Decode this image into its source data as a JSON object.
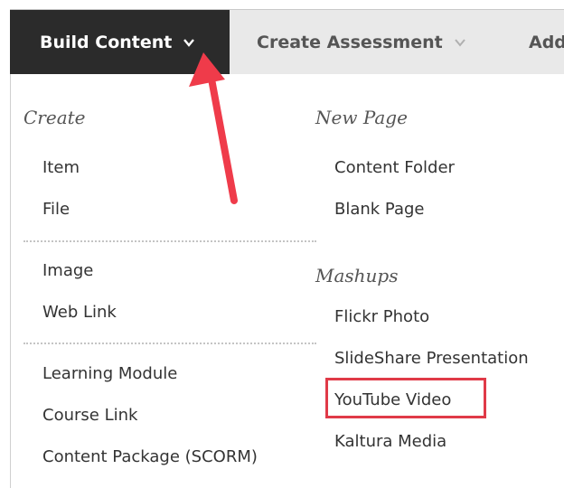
{
  "toolbar": {
    "build_content": "Build Content",
    "create_assessment": "Create Assessment",
    "add_partial": "Add"
  },
  "menu": {
    "create": {
      "heading": "Create",
      "group1": [
        "Item",
        "File"
      ],
      "group2": [
        "Image",
        "Web Link"
      ],
      "group3": [
        "Learning Module",
        "Course Link",
        "Content Package (SCORM)"
      ]
    },
    "new_page": {
      "heading": "New Page",
      "items": [
        "Content Folder",
        "Blank Page"
      ]
    },
    "mashups": {
      "heading": "Mashups",
      "items": [
        "Flickr Photo",
        "SlideShare Presentation",
        "YouTube Video",
        "Kaltura Media"
      ]
    }
  },
  "annotations": {
    "arrow_color": "#ef3b4a",
    "highlight_color": "#e03a48"
  },
  "colors": {
    "active_tab_bg": "#2b2b2b",
    "toolbar_bg": "#e9e9e9"
  }
}
